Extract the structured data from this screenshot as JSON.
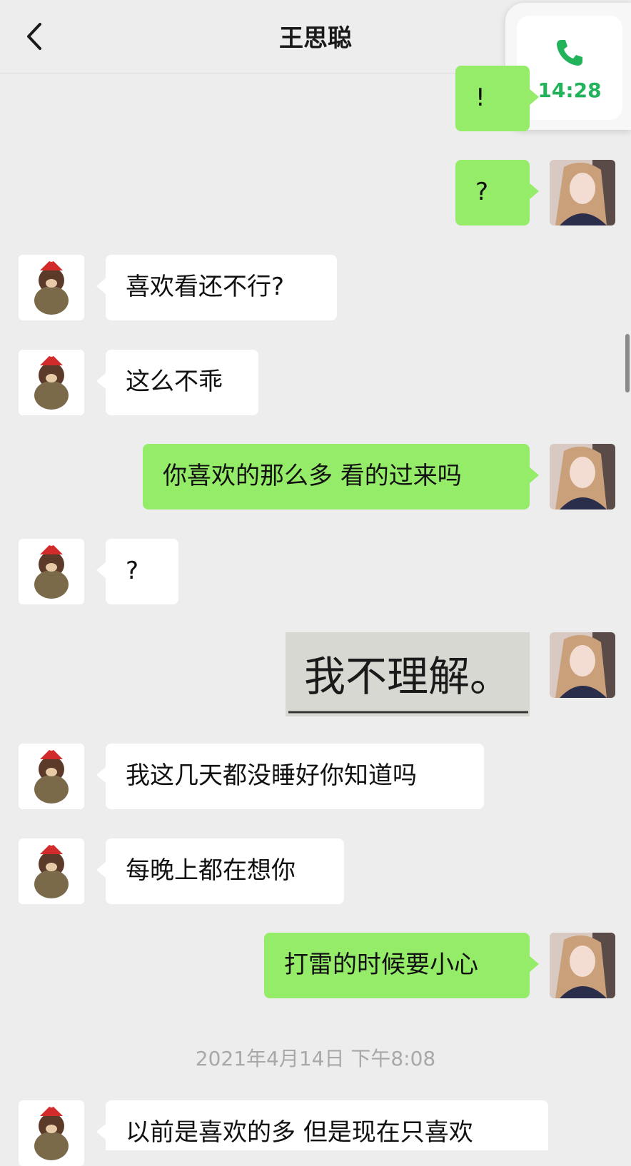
{
  "header": {
    "title": "王思聪"
  },
  "call": {
    "time": "14:28"
  },
  "messages": {
    "m0": "!",
    "m1": "?",
    "m2": "喜欢看还不行?",
    "m3": "这么不乖",
    "m4": "你喜欢的那么多 看的过来吗",
    "m5": "?",
    "m6": "我不理解。",
    "m7": "我这几天都没睡好你知道吗",
    "m8": "每晚上都在想你",
    "m9": "打雷的时候要小心",
    "timestamp": "2021年4月14日 下午8:08",
    "m10": "以前是喜欢的多 但是现在只喜欢"
  },
  "colors": {
    "outgoing": "#95ec69",
    "incoming": "#ffffff",
    "background": "#ededed",
    "call_green": "#22b35a"
  },
  "icons": {
    "back": "chevron-left-icon",
    "call": "phone-icon"
  }
}
